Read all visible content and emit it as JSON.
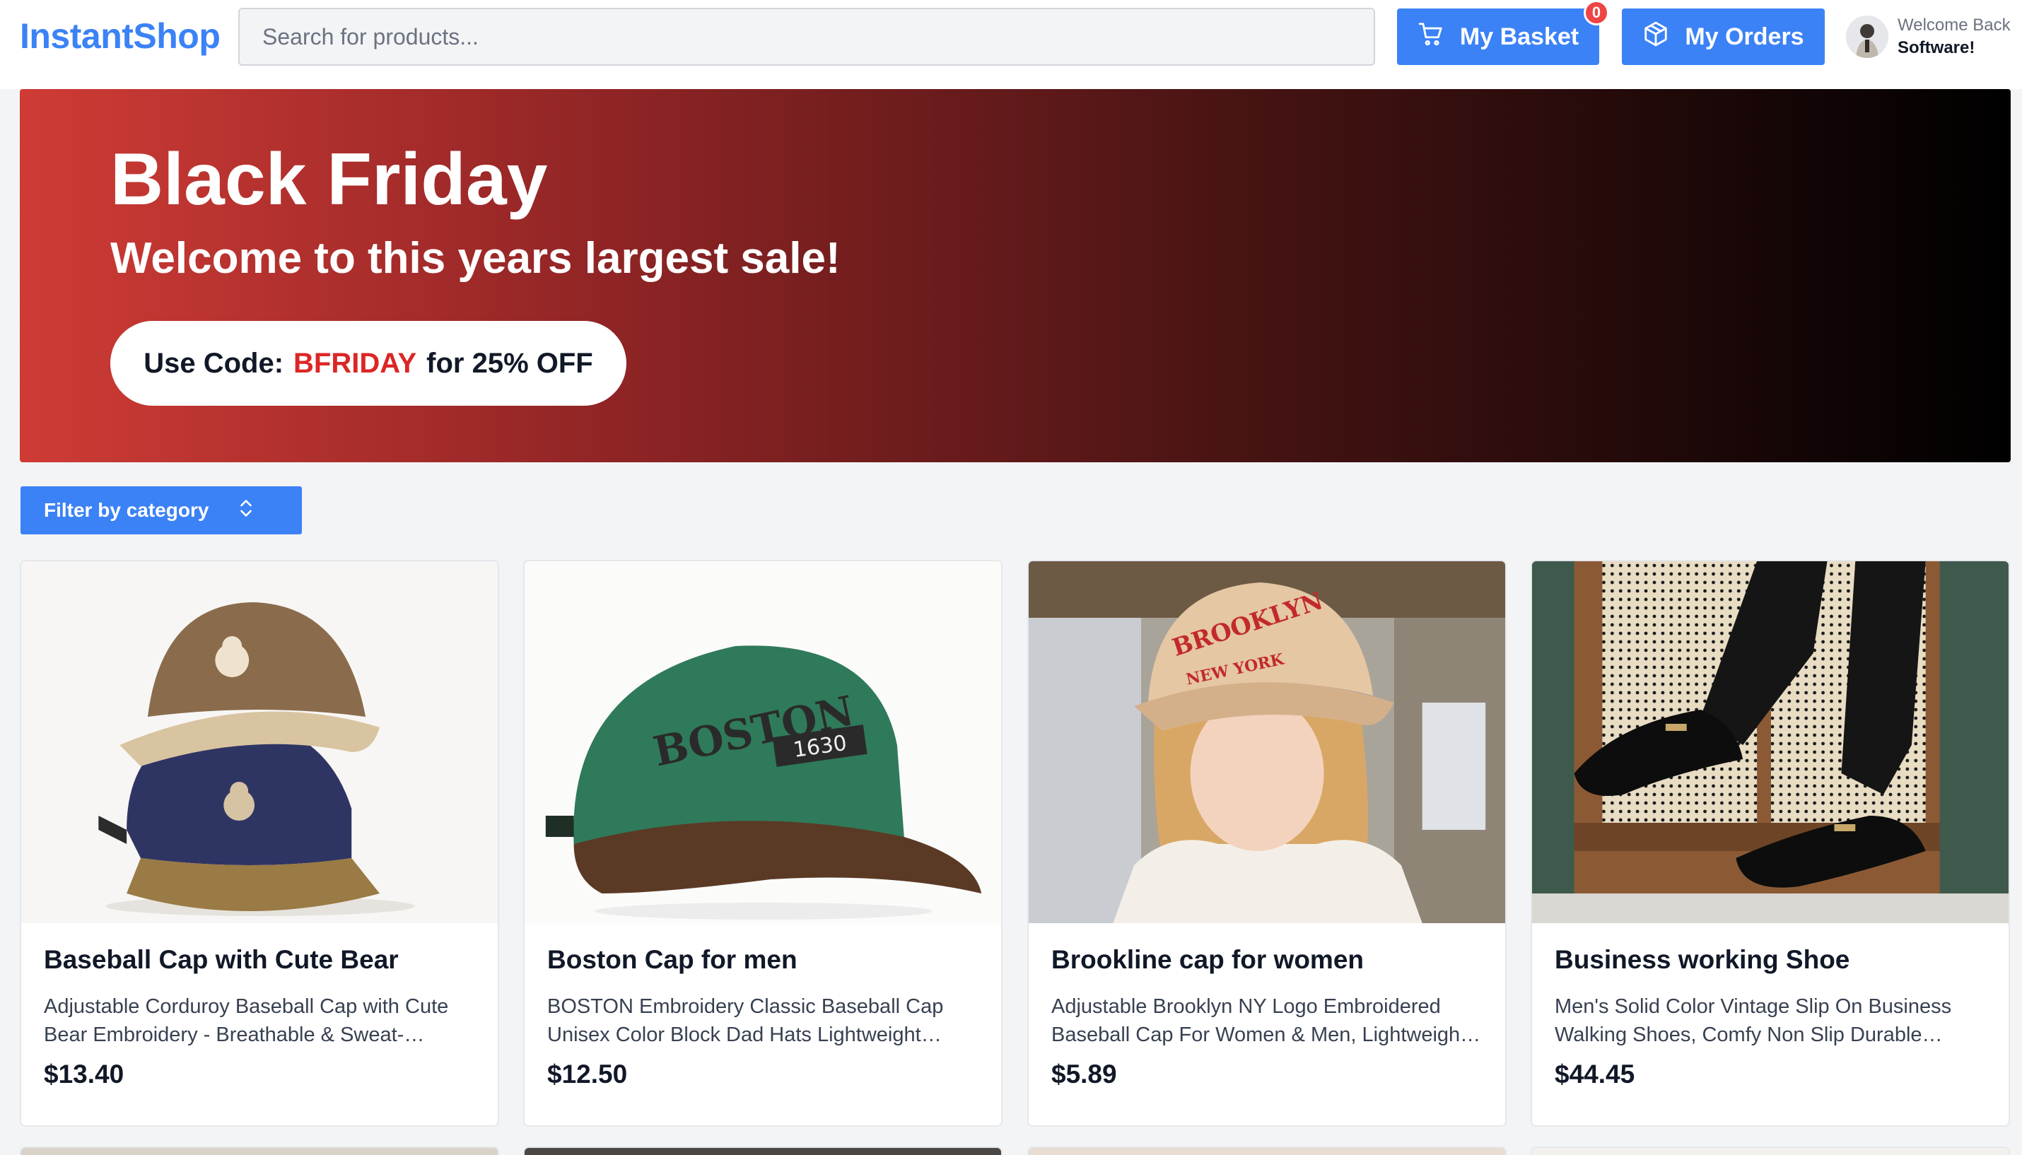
{
  "header": {
    "logo": "InstantShop",
    "search_placeholder": "Search for products...",
    "basket_label": "My Basket",
    "basket_count": "0",
    "orders_label": "My Orders",
    "welcome_line1": "Welcome Back",
    "welcome_line2": "Software!"
  },
  "hero": {
    "title": "Black Friday",
    "subtitle": "Welcome to this years largest sale!",
    "code_prefix": "Use Code:",
    "code": "BFRIDAY",
    "code_suffix": "for 25% OFF"
  },
  "filter": {
    "label": "Filter by category"
  },
  "products": [
    {
      "title": "Baseball Cap with Cute Bear",
      "description": "Adjustable Corduroy Baseball Cap with Cute Bear Embroidery - Breathable & Sweat-Wicking, Perfect for Outdoor Sports",
      "price": "$13.40"
    },
    {
      "title": "Boston Cap for men",
      "description": "BOSTON Embroidery Classic Baseball Cap Unisex Color Block Dad Hats Lightweight Adjustable Sports Hat",
      "price": "$12.50"
    },
    {
      "title": "Brookline cap for women",
      "description": "Adjustable Brooklyn NY Logo Embroidered Baseball Cap For Women & Men, Lightweight Casual Sun Hat",
      "price": "$5.89"
    },
    {
      "title": "Business working Shoe",
      "description": "Men's Solid Color Vintage Slip On Business Walking Shoes, Comfy Non Slip Durable Rubber Sole Loafers",
      "price": "$44.45"
    }
  ],
  "colors": {
    "accent": "#3b82f6",
    "badge": "#ef4444",
    "code": "#dc2626",
    "hero_start": "#cf3b35",
    "hero_end": "#000000"
  }
}
